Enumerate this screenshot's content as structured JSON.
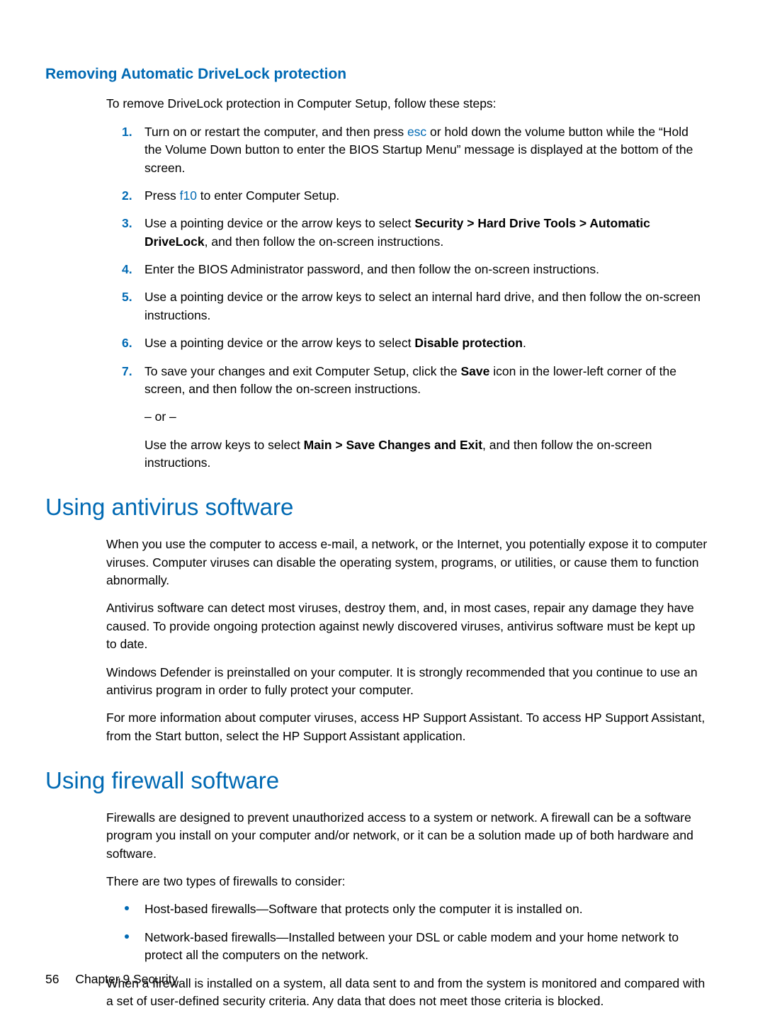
{
  "h3_remove": "Removing Automatic DriveLock protection",
  "intro_remove": "To remove DriveLock protection in Computer Setup, follow these steps:",
  "steps": {
    "s1_a": "Turn on or restart the computer, and then press ",
    "s1_key": "esc",
    "s1_b": " or hold down the volume button while the “Hold the Volume Down button to enter the BIOS Startup Menu” message is displayed at the bottom of the screen.",
    "s2_a": "Press ",
    "s2_key": "f10",
    "s2_b": " to enter Computer Setup.",
    "s3_a": "Use a pointing device or the arrow keys to select ",
    "s3_bold": "Security > Hard Drive Tools > Automatic DriveLock",
    "s3_b": ", and then follow the on-screen instructions.",
    "s4": "Enter the BIOS Administrator password, and then follow the on-screen instructions.",
    "s5": "Use a pointing device or the arrow keys to select an internal hard drive, and then follow the on-screen instructions.",
    "s6_a": "Use a pointing device or the arrow keys to select ",
    "s6_bold": "Disable protection",
    "s6_b": ".",
    "s7_a": "To save your changes and exit Computer Setup, click the ",
    "s7_bold": "Save",
    "s7_b": " icon in the lower-left corner of the screen, and then follow the on-screen instructions.",
    "s7_or": "– or –",
    "s7_c": "Use the arrow keys to select ",
    "s7_bold2": "Main > Save Changes and Exit",
    "s7_d": ", and then follow the on-screen instructions."
  },
  "h1_antivirus": "Using antivirus software",
  "av_p1": "When you use the computer to access e-mail, a network, or the Internet, you potentially expose it to computer viruses. Computer viruses can disable the operating system, programs, or utilities, or cause them to function abnormally.",
  "av_p2": "Antivirus software can detect most viruses, destroy them, and, in most cases, repair any damage they have caused. To provide ongoing protection against newly discovered viruses, antivirus software must be kept up to date.",
  "av_p3": "Windows Defender is preinstalled on your computer. It is strongly recommended that you continue to use an antivirus program in order to fully protect your computer.",
  "av_p4": "For more information about computer viruses, access HP Support Assistant. To access HP Support Assistant, from the Start button, select the HP Support Assistant application.",
  "h1_firewall": "Using firewall software",
  "fw_p1": "Firewalls are designed to prevent unauthorized access to a system or network. A firewall can be a software program you install on your computer and/or network, or it can be a solution made up of both hardware and software.",
  "fw_p2": "There are two types of firewalls to consider:",
  "fw_b1": "Host-based firewalls—Software that protects only the computer it is installed on.",
  "fw_b2": "Network-based firewalls—Installed between your DSL or cable modem and your home network to protect all the computers on the network.",
  "fw_p3": "When a firewall is installed on a system, all data sent to and from the system is monitored and compared with a set of user-defined security criteria. Any data that does not meet those criteria is blocked.",
  "footer_page": "56",
  "footer_text": "Chapter 9   Security"
}
